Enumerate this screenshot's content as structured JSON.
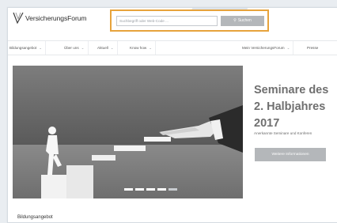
{
  "header": {
    "logo_text": "VersicherungsForum",
    "search": {
      "placeholder": "Suchbegriff oder Web-Code ...",
      "button_label": "Suchen",
      "button_icon": "search-icon"
    }
  },
  "nav": {
    "items": [
      {
        "label": "Bildungsangebot"
      },
      {
        "label": "Über uns"
      },
      {
        "label": "Aktuell"
      },
      {
        "label": "Know how"
      },
      {
        "label": "Mein VersicherungsForum"
      },
      {
        "label": "Presse"
      }
    ]
  },
  "hero": {
    "slide_count": 5,
    "active_slide": 5
  },
  "promo": {
    "title": "Seminare des\n2. Halbjahres\n2017",
    "subtitle": "Anerkannte Seminare und Konferen",
    "button_label": "Weitere Informationen"
  },
  "section": {
    "title": "Bildungsangebot"
  },
  "colors": {
    "search_highlight": "#e7a33c",
    "button_gray": "#b4b7ba",
    "promo_text": "#6f6f6f"
  }
}
